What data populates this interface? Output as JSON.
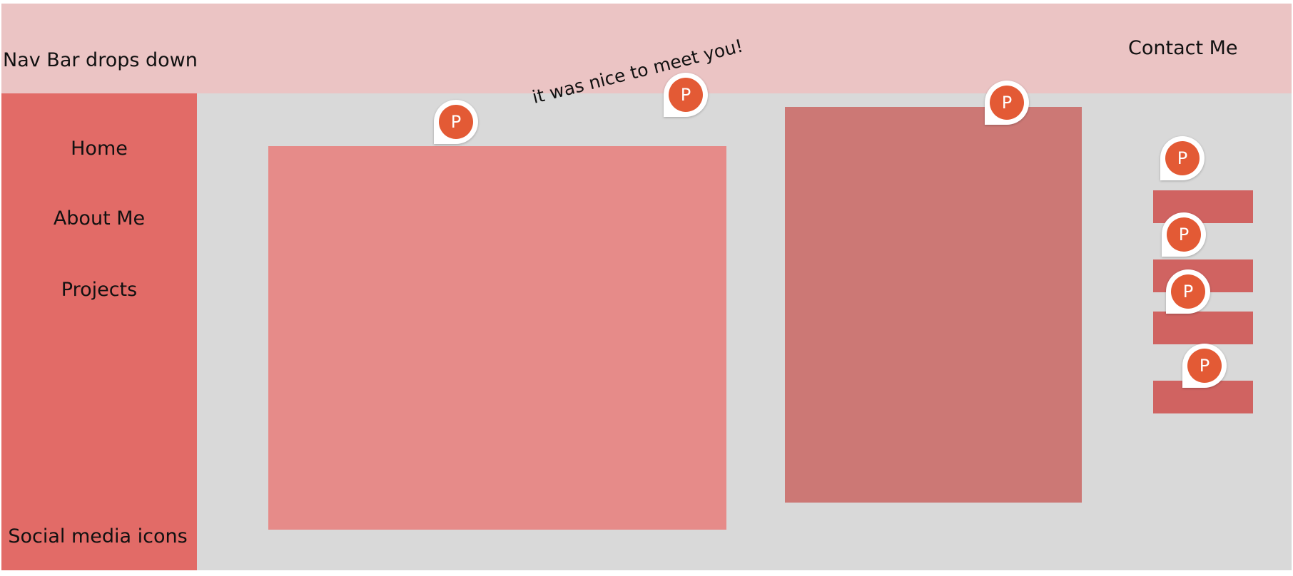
{
  "navbar": {
    "title": "Nav Bar drops down",
    "contact_label": "Contact Me"
  },
  "sidebar": {
    "items": [
      {
        "label": "Home"
      },
      {
        "label": "About Me"
      },
      {
        "label": "Projects"
      }
    ],
    "footer_label": "Social media icons"
  },
  "comment": {
    "text": "it was nice to meet you!"
  },
  "pins": [
    {
      "initial": "P"
    },
    {
      "initial": "P"
    },
    {
      "initial": "P"
    },
    {
      "initial": "P"
    },
    {
      "initial": "P"
    },
    {
      "initial": "P"
    },
    {
      "initial": "P"
    }
  ],
  "colors": {
    "navbar": "#ebc4c4",
    "sidebar": "#e26b67",
    "canvas": "#d9d9d9",
    "large_block": "#e68b89",
    "tall_block": "#cc7875",
    "small_bars": "#d06361",
    "pin_avatar": "#e35a35"
  }
}
